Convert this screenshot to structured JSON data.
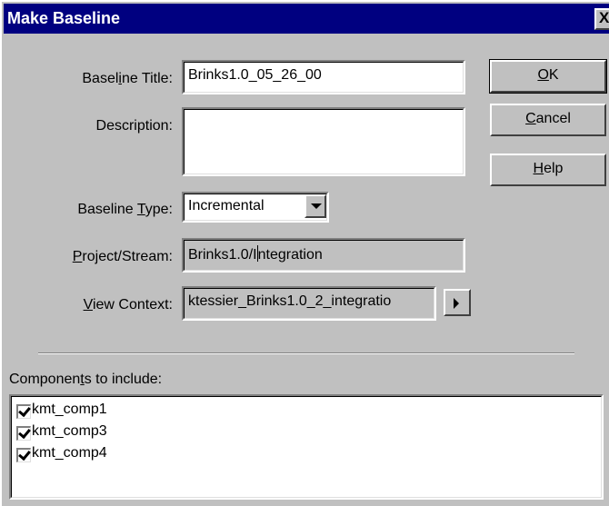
{
  "dialog": {
    "title": "Make Baseline",
    "close_glyph": "X"
  },
  "form": {
    "baseline_title": {
      "label_pre": "Basel",
      "label_ul": "i",
      "label_post": "ne Title:",
      "value": "Brinks1.0_05_26_00"
    },
    "description": {
      "label": "Description:",
      "value": ""
    },
    "baseline_type": {
      "label_pre": "Baseline ",
      "label_ul": "T",
      "label_post": "ype:",
      "value": "Incremental"
    },
    "project_stream": {
      "label_ul": "P",
      "label_post": "roject/Stream:",
      "value_pre": "Brinks1.0/I",
      "value_post": "ntegration"
    },
    "view_context": {
      "label_ul": "V",
      "label_post": "iew Context:",
      "value": "ktessier_Brinks1.0_2_integratio"
    }
  },
  "buttons": {
    "ok": {
      "ul": "O",
      "rest": "K"
    },
    "cancel": {
      "ul": "C",
      "rest": "ancel"
    },
    "help": {
      "ul": "H",
      "rest": "elp"
    }
  },
  "components": {
    "label_pre": "Componen",
    "label_ul": "t",
    "label_post": "s to include:",
    "items": [
      {
        "label": "kmt_comp1",
        "checked": true
      },
      {
        "label": "kmt_comp3",
        "checked": true
      },
      {
        "label": "kmt_comp4",
        "checked": true
      }
    ]
  },
  "icons": {
    "dropdown": "chevron-down-icon",
    "view_context_browse": "triangle-right-icon",
    "checkmark": "checkmark-icon"
  },
  "colors": {
    "titlebar": "#000080",
    "face": "#c0c0c0"
  }
}
